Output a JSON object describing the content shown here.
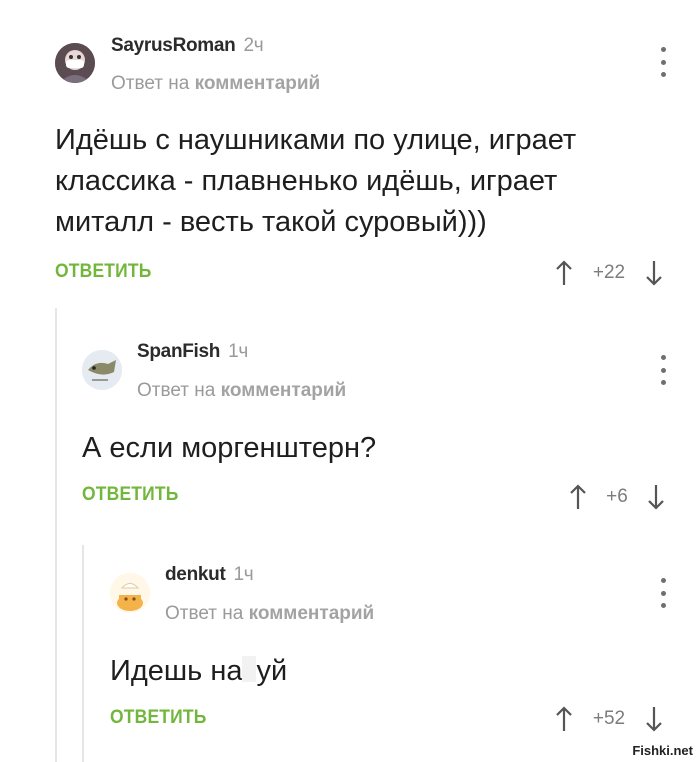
{
  "comments": [
    {
      "author": "SayrusRoman",
      "time": "2ч",
      "reply_prefix": "Ответ на",
      "reply_target": "комментарий",
      "text_lines": [
        "Идёшь с наушниками по улице, играет",
        "классика - плавненько идёшь, играет",
        "миталл - весть такой суровый)))"
      ],
      "reply_label": "ОТВЕТИТЬ",
      "rating": "+22"
    },
    {
      "author": "SpanFish",
      "time": "1ч",
      "reply_prefix": "Ответ на",
      "reply_target": "комментарий",
      "text_lines": [
        "А если моргенштерн?"
      ],
      "reply_label": "ОТВЕТИТЬ",
      "rating": "+6"
    },
    {
      "author": "denkut",
      "time": "1ч",
      "reply_prefix": "Ответ на",
      "reply_target": "комментарий",
      "text_before": "Идешь на",
      "text_after": "уй",
      "reply_label": "ОТВЕТИТЬ",
      "rating": "+52"
    }
  ],
  "watermark": "Fishki.net",
  "colors": {
    "accent": "#72b63b",
    "muted": "#9a9a9a",
    "thread_line": "#e6e6e6"
  },
  "icons": [
    "avatar",
    "more-vertical-icon",
    "upvote-arrow-icon",
    "downvote-arrow-icon"
  ]
}
